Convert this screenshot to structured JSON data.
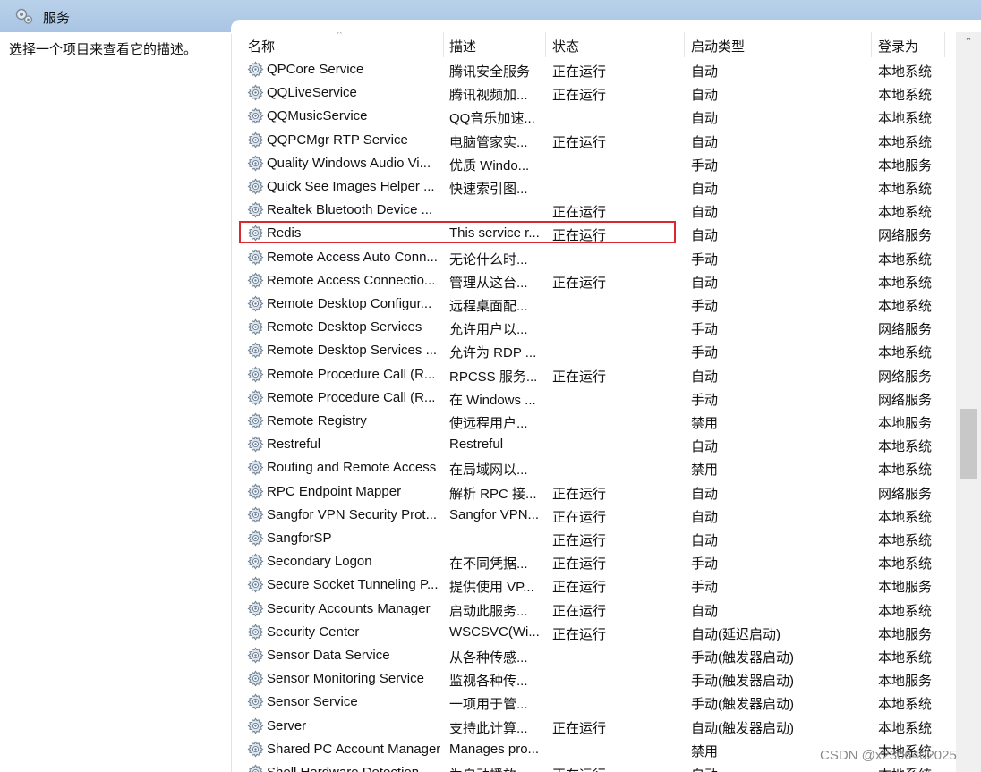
{
  "window": {
    "title": "服务"
  },
  "left_pane": {
    "description": "选择一个项目来查看它的描述。"
  },
  "columns": {
    "name": "名称",
    "description": "描述",
    "status": "状态",
    "startup_type": "启动类型",
    "log_on_as": "登录为"
  },
  "rows": [
    {
      "name": "QPCore Service",
      "description": "腾讯安全服务",
      "status": "正在运行",
      "startup": "自动",
      "logon": "本地系统"
    },
    {
      "name": "QQLiveService",
      "description": "腾讯视频加...",
      "status": "正在运行",
      "startup": "自动",
      "logon": "本地系统"
    },
    {
      "name": "QQMusicService",
      "description": "QQ音乐加速...",
      "status": "",
      "startup": "自动",
      "logon": "本地系统"
    },
    {
      "name": "QQPCMgr RTP Service",
      "description": "电脑管家实...",
      "status": "正在运行",
      "startup": "自动",
      "logon": "本地系统"
    },
    {
      "name": "Quality Windows Audio Vi...",
      "description": "优质 Windo...",
      "status": "",
      "startup": "手动",
      "logon": "本地服务"
    },
    {
      "name": "Quick See Images Helper ...",
      "description": "快速索引图...",
      "status": "",
      "startup": "自动",
      "logon": "本地系统"
    },
    {
      "name": "Realtek Bluetooth Device ...",
      "description": "",
      "status": "正在运行",
      "startup": "自动",
      "logon": "本地系统"
    },
    {
      "name": "Redis",
      "description": "This service r...",
      "status": "正在运行",
      "startup": "自动",
      "logon": "网络服务"
    },
    {
      "name": "Remote Access Auto Conn...",
      "description": "无论什么时...",
      "status": "",
      "startup": "手动",
      "logon": "本地系统"
    },
    {
      "name": "Remote Access Connectio...",
      "description": "管理从这台...",
      "status": "正在运行",
      "startup": "自动",
      "logon": "本地系统"
    },
    {
      "name": "Remote Desktop Configur...",
      "description": "远程桌面配...",
      "status": "",
      "startup": "手动",
      "logon": "本地系统"
    },
    {
      "name": "Remote Desktop Services",
      "description": "允许用户以...",
      "status": "",
      "startup": "手动",
      "logon": "网络服务"
    },
    {
      "name": "Remote Desktop Services ...",
      "description": "允许为 RDP ...",
      "status": "",
      "startup": "手动",
      "logon": "本地系统"
    },
    {
      "name": "Remote Procedure Call (R...",
      "description": "RPCSS 服务...",
      "status": "正在运行",
      "startup": "自动",
      "logon": "网络服务"
    },
    {
      "name": "Remote Procedure Call (R...",
      "description": "在 Windows ...",
      "status": "",
      "startup": "手动",
      "logon": "网络服务"
    },
    {
      "name": "Remote Registry",
      "description": "使远程用户...",
      "status": "",
      "startup": "禁用",
      "logon": "本地服务"
    },
    {
      "name": "Restreful",
      "description": "Restreful",
      "status": "",
      "startup": "自动",
      "logon": "本地系统"
    },
    {
      "name": "Routing and Remote Access",
      "description": "在局域网以...",
      "status": "",
      "startup": "禁用",
      "logon": "本地系统"
    },
    {
      "name": "RPC Endpoint Mapper",
      "description": "解析 RPC 接...",
      "status": "正在运行",
      "startup": "自动",
      "logon": "网络服务"
    },
    {
      "name": "Sangfor VPN Security Prot...",
      "description": "Sangfor VPN...",
      "status": "正在运行",
      "startup": "自动",
      "logon": "本地系统"
    },
    {
      "name": "SangforSP",
      "description": "",
      "status": "正在运行",
      "startup": "自动",
      "logon": "本地系统"
    },
    {
      "name": "Secondary Logon",
      "description": "在不同凭据...",
      "status": "正在运行",
      "startup": "手动",
      "logon": "本地系统"
    },
    {
      "name": "Secure Socket Tunneling P...",
      "description": "提供使用 VP...",
      "status": "正在运行",
      "startup": "手动",
      "logon": "本地服务"
    },
    {
      "name": "Security Accounts Manager",
      "description": "启动此服务...",
      "status": "正在运行",
      "startup": "自动",
      "logon": "本地系统"
    },
    {
      "name": "Security Center",
      "description": "WSCSVC(Wi...",
      "status": "正在运行",
      "startup": "自动(延迟启动)",
      "logon": "本地服务"
    },
    {
      "name": "Sensor Data Service",
      "description": "从各种传感...",
      "status": "",
      "startup": "手动(触发器启动)",
      "logon": "本地系统"
    },
    {
      "name": "Sensor Monitoring Service",
      "description": "监视各种传...",
      "status": "",
      "startup": "手动(触发器启动)",
      "logon": "本地服务"
    },
    {
      "name": "Sensor Service",
      "description": "一项用于管...",
      "status": "",
      "startup": "手动(触发器启动)",
      "logon": "本地系统"
    },
    {
      "name": "Server",
      "description": "支持此计算...",
      "status": "正在运行",
      "startup": "自动(触发器启动)",
      "logon": "本地系统"
    },
    {
      "name": "Shared PC Account Manager",
      "description": "Manages pro...",
      "status": "",
      "startup": "禁用",
      "logon": "本地系统"
    },
    {
      "name": "Shell Hardware Detection",
      "description": "为自动播放...",
      "status": "正在运行",
      "startup": "自动",
      "logon": "本地系统"
    }
  ],
  "highlighted_service": "Redis",
  "scrollbar": {
    "up_arrow": "⌃"
  },
  "watermark": "CSDN @x2306402025"
}
